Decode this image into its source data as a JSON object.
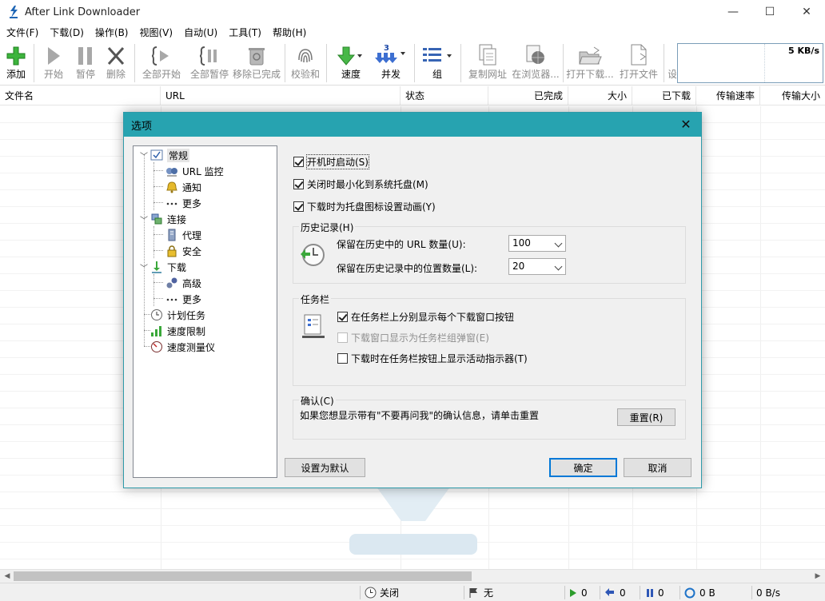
{
  "app": {
    "title": "After Link Downloader",
    "controls": {
      "minimize": "—",
      "maximize": "☐",
      "close": "✕"
    }
  },
  "menu": [
    "文件(F)",
    "下载(D)",
    "操作(B)",
    "视图(V)",
    "自动(U)",
    "工具(T)",
    "帮助(H)"
  ],
  "toolbar": {
    "add": "添加",
    "start": "开始",
    "pause": "暂停",
    "delete": "删除",
    "start_all": "全部开始",
    "pause_all": "全部暂停",
    "remove_completed": "移除已完成",
    "checksum": "校验和",
    "speed": "速度",
    "concurrent": "并发",
    "group": "组",
    "copy_url": "复制网址",
    "in_browser": "在浏览器...",
    "open_folder": "打开下载...",
    "open_file": "打开文件",
    "settings_partial": "设",
    "speed_value": "5 KB/s"
  },
  "columns": [
    "文件名",
    "URL",
    "状态",
    "已完成",
    "大小",
    "已下载",
    "传输速率",
    "传输大小"
  ],
  "dialog": {
    "title": "选项",
    "close": "✕",
    "tree": {
      "general": "常规",
      "url_monitor": "URL 监控",
      "notify": "通知",
      "more1": "更多",
      "connection": "连接",
      "proxy": "代理",
      "security": "安全",
      "download": "下载",
      "advanced": "高级",
      "more2": "更多",
      "scheduler": "计划任务",
      "speed_limit": "速度限制",
      "speed_meter": "速度测量仪"
    },
    "opts": {
      "autostart": "开机时启动(S)",
      "minimize_tray": "关闭时最小化到系统托盘(M)",
      "tray_anim": "下载时为托盘图标设置动画(Y)"
    },
    "history": {
      "title": "历史记录(H)",
      "url_count_label": "保留在历史中的 URL 数量(U):",
      "url_count_value": "100",
      "loc_count_label": "保留在历史记录中的位置数量(L):",
      "loc_count_value": "20"
    },
    "taskbar": {
      "title": "任务栏",
      "separate": "在任务栏上分别显示每个下载窗口按钮",
      "popup": "下载窗口显示为任务栏组弹窗(E)",
      "indicator": "下载时在任务栏按钮上显示活动指示器(T)"
    },
    "confirm": {
      "title": "确认(C)",
      "text": "如果您想显示带有\"不要再问我\"的确认信息，请单击重置",
      "reset": "重置(R)"
    },
    "buttons": {
      "defaults": "设置为默认",
      "ok": "确定",
      "cancel": "取消"
    }
  },
  "status": {
    "scheduler": "关闭",
    "flag": "无",
    "active": "0",
    "queued": "0",
    "paused": "0",
    "total": "0 B",
    "rate": "0 B/s"
  }
}
